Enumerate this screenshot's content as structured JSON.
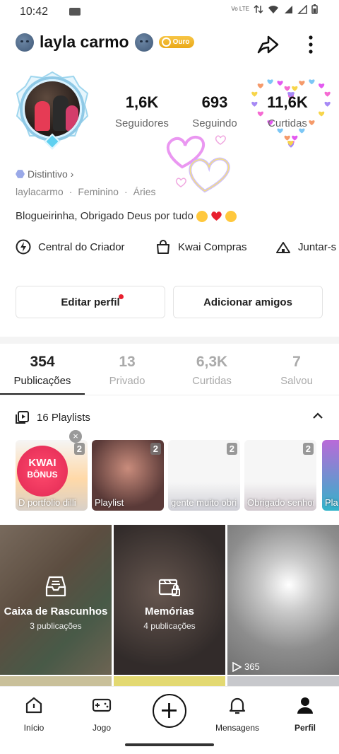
{
  "status_bar": {
    "time": "10:42",
    "network": "Vo LTE"
  },
  "profile": {
    "username": "layla carmo",
    "badge": "Ouro",
    "stats": [
      {
        "value": "1,6K",
        "label": "Seguidores"
      },
      {
        "value": "693",
        "label": "Seguindo"
      },
      {
        "value": "11,6K",
        "label": "Curtidas"
      }
    ],
    "distintivo": "Distintivo",
    "meta": [
      "laylacarmo",
      "·",
      "Feminino",
      "·",
      "Áries"
    ],
    "bio": "Blogueirinha, Obrigado Deus por tudo"
  },
  "quick_links": [
    {
      "label": "Central do Criador",
      "icon": "bolt-icon"
    },
    {
      "label": "Kwai Compras",
      "icon": "shopping-bag-icon"
    },
    {
      "label": "Juntar-s",
      "icon": "tent-icon"
    }
  ],
  "actions": {
    "edit": "Editar perfil",
    "add_friends": "Adicionar amigos"
  },
  "tabs": [
    {
      "value": "354",
      "label": "Publicações"
    },
    {
      "value": "13",
      "label": "Privado"
    },
    {
      "value": "6,3K",
      "label": "Curtidas"
    },
    {
      "value": "7",
      "label": "Salvou"
    }
  ],
  "playlists": {
    "header": "16 Playlists",
    "cards": [
      {
        "count": "2",
        "caption": "D   portfolio dilli",
        "badge_title": "KWAI",
        "badge_sub": "BÔNUS"
      },
      {
        "count": "2",
        "caption": "Playlist"
      },
      {
        "count": "2",
        "caption": "gente muito obrigado por"
      },
      {
        "count": "2",
        "caption": "Obrigado senhor mais"
      },
      {
        "count": "",
        "caption": "Pla"
      }
    ]
  },
  "grid": [
    {
      "title": "Caixa de Rascunhos",
      "subtitle": "3 publicações",
      "icon": "inbox-icon"
    },
    {
      "title": "Memórias",
      "subtitle": "4 publicações",
      "icon": "memories-icon"
    },
    {
      "plays": "365"
    }
  ],
  "nav": [
    {
      "label": "Início",
      "icon": "home-icon"
    },
    {
      "label": "Jogo",
      "icon": "gamepad-icon"
    },
    {
      "label": "",
      "icon": "plus-icon"
    },
    {
      "label": "Mensagens",
      "icon": "bell-icon"
    },
    {
      "label": "Perfil",
      "icon": "person-icon"
    }
  ]
}
